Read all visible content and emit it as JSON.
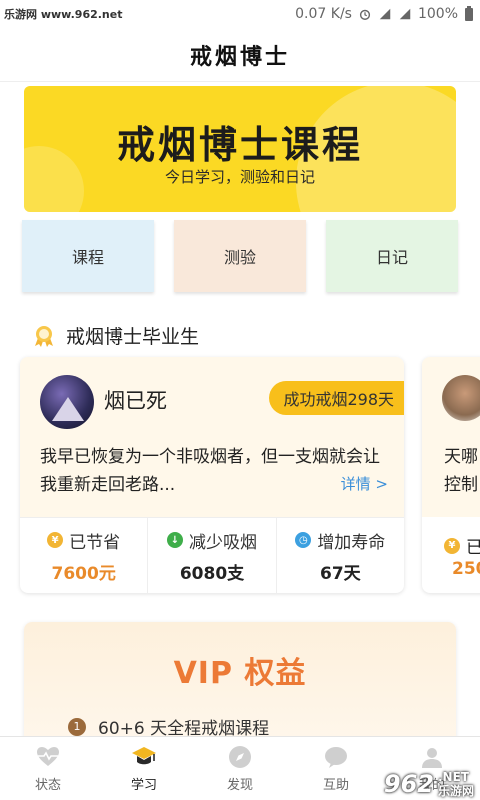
{
  "status_bar": {
    "left_text": "乐游网 www.962.net",
    "speed": "0.07 K/s",
    "battery": "100%"
  },
  "header": {
    "title": "戒烟博士"
  },
  "banner": {
    "title": "戒烟博士课程",
    "subtitle": "今日学习，测验和日记",
    "color": "#fbd924"
  },
  "tiles": [
    {
      "label": "课程",
      "color": "#e0f0f9"
    },
    {
      "label": "测验",
      "color": "#f9e8da"
    },
    {
      "label": "日记",
      "color": "#e4f5e3"
    }
  ],
  "section": {
    "title": "戒烟博士毕业生"
  },
  "graduates": [
    {
      "name": "烟已死",
      "badge": "成功戒烟298天",
      "quote": "我早已恢复为一个非吸烟者，但一支烟就会让我重新走回老路...",
      "more": "详情 >",
      "stats": [
        {
          "icon": "yen-icon",
          "label": "已节省",
          "value": "7600元"
        },
        {
          "icon": "down-arrow-icon",
          "label": "减少吸烟",
          "value": "6080支"
        },
        {
          "icon": "clock-icon",
          "label": "增加寿命",
          "value": "67天"
        }
      ]
    },
    {
      "quote_line1": "天哪",
      "quote_line2": "控制",
      "stat_label": "已",
      "stat_value": "250"
    }
  ],
  "vip": {
    "title": "VIP 权益",
    "items": [
      {
        "num": "1",
        "text": "60+6 天全程戒烟课程"
      }
    ]
  },
  "tabbar": [
    {
      "label": "状态",
      "icon": "heartbeat-icon",
      "active": false
    },
    {
      "label": "学习",
      "icon": "graduation-cap-icon",
      "active": true
    },
    {
      "label": "发现",
      "icon": "compass-icon",
      "active": false
    },
    {
      "label": "互助",
      "icon": "chat-icon",
      "active": false
    },
    {
      "label": "我的",
      "icon": "user-icon",
      "active": false
    }
  ],
  "watermark": {
    "logo": "962",
    "site_line1": ".NET",
    "site_line2": "乐游网"
  }
}
